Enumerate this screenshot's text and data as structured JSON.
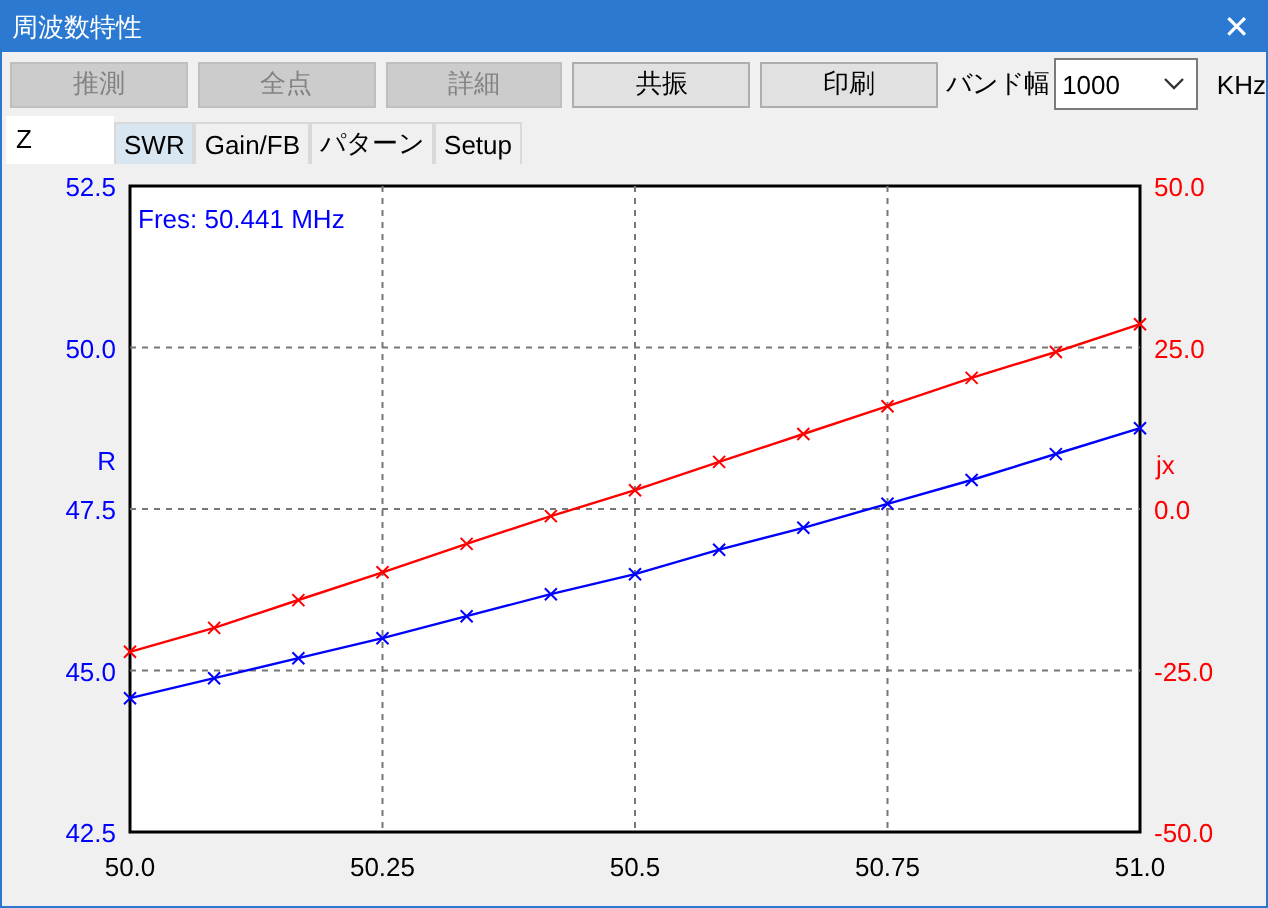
{
  "window": {
    "title": "周波数特性",
    "close": "✕"
  },
  "toolbar": {
    "buttons": [
      {
        "label": "推測",
        "disabled": true
      },
      {
        "label": "全点",
        "disabled": true
      },
      {
        "label": "詳細",
        "disabled": true
      },
      {
        "label": "共振",
        "disabled": false
      },
      {
        "label": "印刷",
        "disabled": false
      }
    ],
    "bandwidth": {
      "label": "バンド幅",
      "value": "1000",
      "unit": "KHz"
    }
  },
  "tabs": [
    {
      "label": "Z",
      "selected": true,
      "highlighted": false
    },
    {
      "label": "SWR",
      "selected": false,
      "highlighted": true
    },
    {
      "label": "Gain/FB",
      "selected": false,
      "highlighted": false
    },
    {
      "label": "パターン",
      "selected": false,
      "highlighted": false
    },
    {
      "label": "Setup",
      "selected": false,
      "highlighted": false
    }
  ],
  "chart": {
    "chart_data": {
      "type": "line",
      "grid": true,
      "x": [
        50.0,
        50.0833,
        50.1667,
        50.25,
        50.3333,
        50.4167,
        50.5,
        50.5833,
        50.6667,
        50.75,
        50.8333,
        50.9167,
        51.0
      ],
      "series": [
        {
          "name": "R",
          "color": "#0000ff",
          "marker": "x",
          "values": [
            44.57,
            44.88,
            45.19,
            45.5,
            45.84,
            46.18,
            46.49,
            46.87,
            47.21,
            47.58,
            47.95,
            48.35,
            48.75
          ]
        },
        {
          "name": "jx",
          "color": "#ff0000",
          "axis": "y2",
          "marker": "x",
          "values": [
            -22.1,
            -18.4,
            -14.1,
            -9.8,
            -5.4,
            -1.1,
            2.9,
            7.3,
            11.6,
            15.9,
            20.3,
            24.3,
            28.6
          ]
        }
      ],
      "xlim": [
        50.0,
        51.0
      ],
      "ylim": [
        42.5,
        52.5
      ],
      "y2lim": [
        -50,
        50
      ],
      "xticks": [
        {
          "value": 50.0,
          "label": "50.0"
        },
        {
          "value": 50.25,
          "label": "50.25"
        },
        {
          "value": 50.5,
          "label": "50.5"
        },
        {
          "value": 50.75,
          "label": "50.75"
        },
        {
          "value": 51.0,
          "label": "51.0"
        }
      ],
      "yticks": [
        {
          "value": 42.5,
          "label": "42.5"
        },
        {
          "value": 45,
          "label": "45.0"
        },
        {
          "value": 47.5,
          "label": "47.5"
        },
        {
          "value": 50,
          "label": "50.0"
        },
        {
          "value": 52.5,
          "label": "52.5"
        }
      ],
      "y2ticks": [
        {
          "value": -50,
          "label": "-50.0"
        },
        {
          "value": -25,
          "label": "-25.0"
        },
        {
          "value": 0,
          "label": "0.0"
        },
        {
          "value": 25,
          "label": "25.0"
        },
        {
          "value": 50,
          "label": "50.0"
        }
      ],
      "annotations": [
        {
          "text": "Fres: 50.441 MHz"
        }
      ]
    }
  }
}
